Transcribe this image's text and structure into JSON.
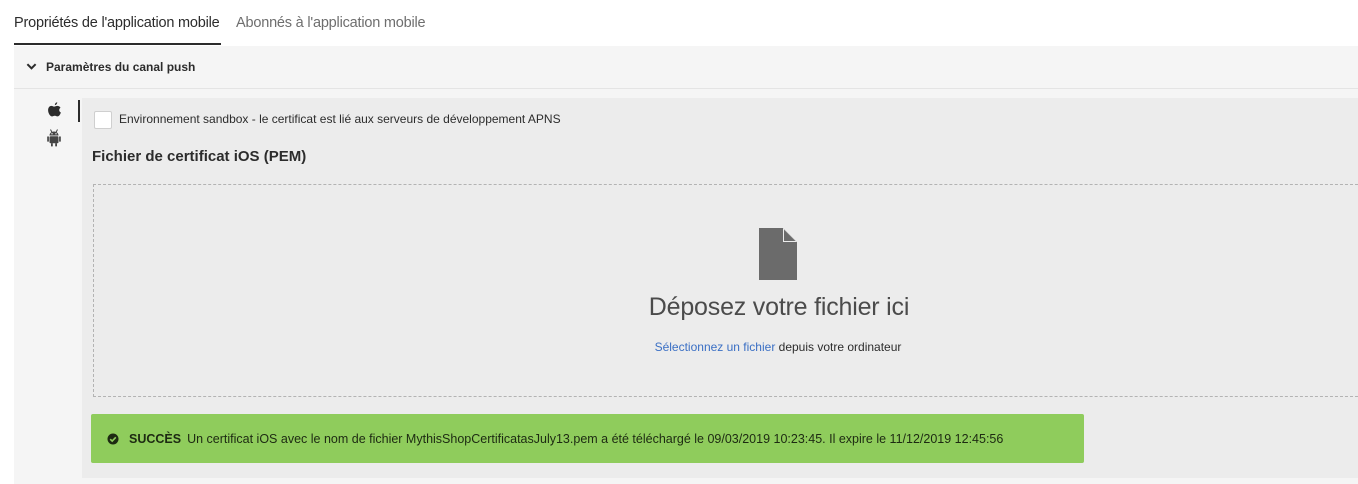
{
  "tabs": {
    "properties": "Propriétés de l'application mobile",
    "subscribers": "Abonnés à l'application mobile"
  },
  "section": {
    "title": "Paramètres du canal push"
  },
  "platforms": [
    "apple-icon",
    "android-icon"
  ],
  "sandbox": {
    "label": "Environnement sandbox - le certificat est lié aux serveurs de développement APNS",
    "checked": false
  },
  "certificate": {
    "label": "Fichier de certificat iOS (PEM)"
  },
  "dropzone": {
    "title": "Déposez votre fichier ici",
    "link": "Sélectionnez un fichier",
    "suffix": " depuis votre ordinateur"
  },
  "success": {
    "label": "SUCCÈS",
    "message": "Un certificat iOS avec le nom de fichier MythisShopCertificatasJuly13.pem a été téléchargé le 09/03/2019 10:23:45. Il expire le  11/12/2019 12:45:56"
  },
  "colors": {
    "success_bg": "#8fcc5c",
    "link": "#3a6fc4"
  }
}
